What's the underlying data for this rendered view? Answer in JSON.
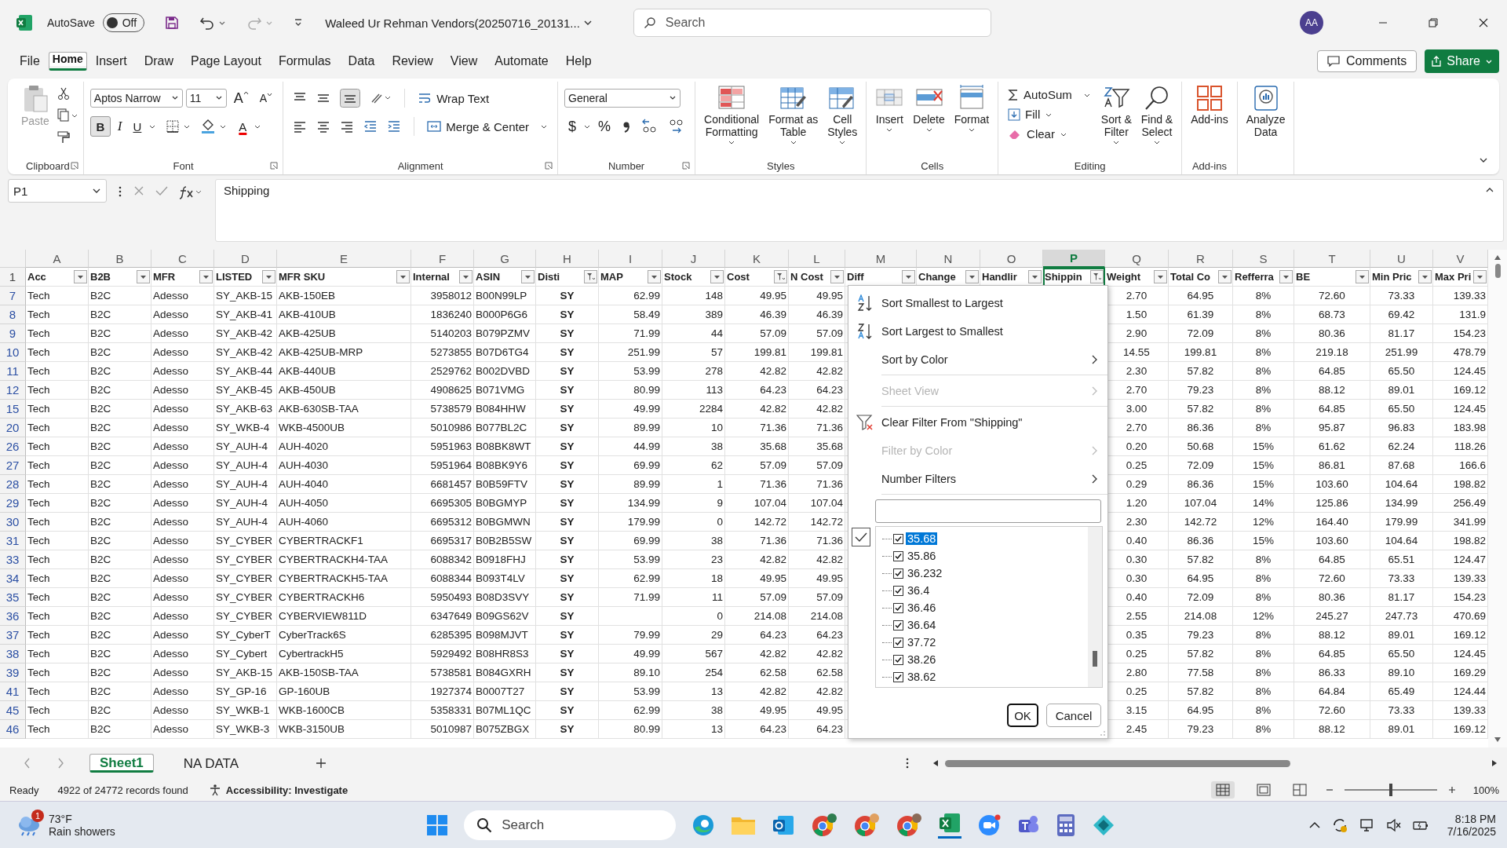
{
  "title_bar": {
    "autosave_label": "AutoSave",
    "autosave": {
      "on": false,
      "label": "Off"
    },
    "file_name": "Waleed Ur Rehman Vendors(20250716_20131...",
    "search_placeholder": "Search",
    "avatar": "AA"
  },
  "menu_tabs": [
    {
      "label": "File",
      "selected": false
    },
    {
      "label": "Home",
      "selected": true
    },
    {
      "label": "Insert",
      "selected": false
    },
    {
      "label": "Draw",
      "selected": false
    },
    {
      "label": "Page Layout",
      "selected": false
    },
    {
      "label": "Formulas",
      "selected": false
    },
    {
      "label": "Data",
      "selected": false
    },
    {
      "label": "Review",
      "selected": false
    },
    {
      "label": "View",
      "selected": false
    },
    {
      "label": "Automate",
      "selected": false
    },
    {
      "label": "Help",
      "selected": false
    }
  ],
  "comments": "Comments",
  "share": "Share",
  "ribbon": {
    "groups": [
      {
        "kind": "clipboard",
        "name": "Clipboard",
        "paste": {
          "label": "Paste",
          "disabled": true
        }
      },
      {
        "kind": "font",
        "name": "Font",
        "font": "Aptos Narrow",
        "size": "11",
        "grow": "A",
        "shrink": "A",
        "bold": {
          "label": "B",
          "on": true
        },
        "italic": "I",
        "underline": "U",
        "color_letter": "A"
      },
      {
        "kind": "alignment",
        "name": "Alignment",
        "wrap": "Wrap Text",
        "merge": "Merge & Center"
      },
      {
        "kind": "number",
        "name": "Number",
        "format": "General",
        "currency": "$",
        "percent": "%"
      },
      {
        "kind": "big",
        "name": "Styles",
        "buttons": [
          {
            "label": "Conditional\nFormatting",
            "caret": true
          },
          {
            "label": "Format as\nTable",
            "caret": true
          },
          {
            "label": "Cell\nStyles",
            "caret": true
          }
        ]
      },
      {
        "kind": "big",
        "name": "Cells",
        "buttons": [
          {
            "label": "Insert",
            "caret": true
          },
          {
            "label": "Delete",
            "caret": true
          },
          {
            "label": "Format",
            "caret": true
          }
        ]
      },
      {
        "kind": "editing",
        "name": "Editing",
        "autosum": "AutoSum",
        "fill": "Fill",
        "clear": "Clear",
        "buttons": [
          {
            "label": "Sort &\nFilter",
            "caret": true
          },
          {
            "label": "Find &\nSelect",
            "caret": true
          }
        ]
      },
      {
        "kind": "big",
        "name": "Add-ins",
        "buttons": [
          {
            "label": "Add-ins",
            "caret": false
          }
        ]
      },
      {
        "kind": "big",
        "buttons": [
          {
            "label": "Analyze\nData",
            "caret": false
          }
        ]
      }
    ]
  },
  "formula_bar": {
    "name_box": "P1",
    "formula": "Shipping"
  },
  "sheet": {
    "header_row": "1",
    "columns": [
      {
        "letter": "A",
        "selected": false
      },
      {
        "letter": "B",
        "selected": false
      },
      {
        "letter": "C",
        "selected": false
      },
      {
        "letter": "D",
        "selected": false
      },
      {
        "letter": "E",
        "selected": false
      },
      {
        "letter": "F",
        "selected": false
      },
      {
        "letter": "G",
        "selected": false
      },
      {
        "letter": "H",
        "selected": false
      },
      {
        "letter": "I",
        "selected": false
      },
      {
        "letter": "J",
        "selected": false
      },
      {
        "letter": "K",
        "selected": false
      },
      {
        "letter": "L",
        "selected": false
      },
      {
        "letter": "M",
        "selected": false
      },
      {
        "letter": "N",
        "selected": false
      },
      {
        "letter": "O",
        "selected": false
      },
      {
        "letter": "P",
        "selected": true
      },
      {
        "letter": "Q",
        "selected": false
      },
      {
        "letter": "R",
        "selected": false
      },
      {
        "letter": "S",
        "selected": false
      },
      {
        "letter": "T",
        "selected": false
      },
      {
        "letter": "U",
        "selected": false
      },
      {
        "letter": "V",
        "selected": false
      }
    ],
    "headers": [
      {
        "label": "Acc",
        "filtered": false
      },
      {
        "label": "B2B",
        "filtered": false
      },
      {
        "label": "MFR",
        "filtered": false
      },
      {
        "label": "LISTED",
        "filtered": false
      },
      {
        "label": "MFR SKU",
        "filtered": false
      },
      {
        "label": "Internal",
        "filtered": false
      },
      {
        "label": "ASIN",
        "filtered": false
      },
      {
        "label": "Disti",
        "filtered": true
      },
      {
        "label": "MAP",
        "filtered": false
      },
      {
        "label": "Stock",
        "filtered": false
      },
      {
        "label": "Cost",
        "filtered": true
      },
      {
        "label": "N Cost",
        "filtered": false
      },
      {
        "label": "Diff",
        "filtered": false
      },
      {
        "label": "Change",
        "filtered": false
      },
      {
        "label": "Handlir",
        "filtered": false
      },
      {
        "label": "Shippin",
        "filtered": true
      },
      {
        "label": "Weight",
        "filtered": false
      },
      {
        "label": "Total Co",
        "filtered": false
      },
      {
        "label": "Refferra",
        "filtered": false
      },
      {
        "label": "BE",
        "filtered": false
      },
      {
        "label": "Min Pric",
        "filtered": false
      },
      {
        "label": "Max Pri",
        "filtered": false
      }
    ],
    "rows": [
      {
        "row": "7",
        "cells": [
          "Tech",
          "B2C",
          "Adesso",
          "SY_AKB-15",
          "AKB-150EB",
          "3958012",
          "B00N99LP",
          "SY",
          "62.99",
          "148",
          "49.95",
          "49.95",
          null,
          null,
          null,
          null,
          "2.70",
          "64.95",
          "8%",
          "72.60",
          "73.33",
          "139.33"
        ]
      },
      {
        "row": "8",
        "cells": [
          "Tech",
          "B2C",
          "Adesso",
          "SY_AKB-41",
          "AKB-410UB",
          "1836240",
          "B000P6G6",
          "SY",
          "58.49",
          "389",
          "46.39",
          "46.39",
          null,
          null,
          null,
          null,
          "1.50",
          "61.39",
          "8%",
          "68.73",
          "69.42",
          "131.9"
        ]
      },
      {
        "row": "9",
        "cells": [
          "Tech",
          "B2C",
          "Adesso",
          "SY_AKB-42",
          "AKB-425UB",
          "5140203",
          "B079PZMV",
          "SY",
          "71.99",
          "44",
          "57.09",
          "57.09",
          null,
          null,
          null,
          null,
          "2.90",
          "72.09",
          "8%",
          "80.36",
          "81.17",
          "154.23"
        ]
      },
      {
        "row": "10",
        "cells": [
          "Tech",
          "B2C",
          "Adesso",
          "SY_AKB-42",
          "AKB-425UB-MRP",
          "5273855",
          "B07D6TG4",
          "SY",
          "251.99",
          "57",
          "199.81",
          "199.81",
          null,
          null,
          null,
          null,
          "14.55",
          "199.81",
          "8%",
          "219.18",
          "251.99",
          "478.79"
        ]
      },
      {
        "row": "11",
        "cells": [
          "Tech",
          "B2C",
          "Adesso",
          "SY_AKB-44",
          "AKB-440UB",
          "2529762",
          "B002DVBD",
          "SY",
          "53.99",
          "278",
          "42.82",
          "42.82",
          null,
          null,
          null,
          null,
          "2.30",
          "57.82",
          "8%",
          "64.85",
          "65.50",
          "124.45"
        ]
      },
      {
        "row": "12",
        "cells": [
          "Tech",
          "B2C",
          "Adesso",
          "SY_AKB-45",
          "AKB-450UB",
          "4908625",
          "B071VMG",
          "SY",
          "80.99",
          "113",
          "64.23",
          "64.23",
          null,
          null,
          null,
          null,
          "2.70",
          "79.23",
          "8%",
          "88.12",
          "89.01",
          "169.12"
        ]
      },
      {
        "row": "15",
        "cells": [
          "Tech",
          "B2C",
          "Adesso",
          "SY_AKB-63",
          "AKB-630SB-TAA",
          "5738579",
          "B084HHW",
          "SY",
          "49.99",
          "2284",
          "42.82",
          "42.82",
          null,
          null,
          null,
          null,
          "3.00",
          "57.82",
          "8%",
          "64.85",
          "65.50",
          "124.45"
        ]
      },
      {
        "row": "20",
        "cells": [
          "Tech",
          "B2C",
          "Adesso",
          "SY_WKB-4",
          "WKB-4500UB",
          "5010986",
          "B077BL2C",
          "SY",
          "89.99",
          "10",
          "71.36",
          "71.36",
          null,
          null,
          null,
          null,
          "2.70",
          "86.36",
          "8%",
          "95.87",
          "96.83",
          "183.98"
        ]
      },
      {
        "row": "26",
        "cells": [
          "Tech",
          "B2C",
          "Adesso",
          "SY_AUH-4",
          "AUH-4020",
          "5951963",
          "B08BK8WT",
          "SY",
          "44.99",
          "38",
          "35.68",
          "35.68",
          null,
          null,
          null,
          null,
          "0.20",
          "50.68",
          "15%",
          "61.62",
          "62.24",
          "118.26"
        ]
      },
      {
        "row": "27",
        "cells": [
          "Tech",
          "B2C",
          "Adesso",
          "SY_AUH-4",
          "AUH-4030",
          "5951964",
          "B08BK9Y6",
          "SY",
          "69.99",
          "62",
          "57.09",
          "57.09",
          null,
          null,
          null,
          null,
          "0.25",
          "72.09",
          "15%",
          "86.81",
          "87.68",
          "166.6"
        ]
      },
      {
        "row": "28",
        "cells": [
          "Tech",
          "B2C",
          "Adesso",
          "SY_AUH-4",
          "AUH-4040",
          "6681457",
          "B0B59FTV",
          "SY",
          "89.99",
          "1",
          "71.36",
          "71.36",
          null,
          null,
          null,
          null,
          "0.29",
          "86.36",
          "15%",
          "103.60",
          "104.64",
          "198.82"
        ]
      },
      {
        "row": "29",
        "cells": [
          "Tech",
          "B2C",
          "Adesso",
          "SY_AUH-4",
          "AUH-4050",
          "6695305",
          "B0BGMYP",
          "SY",
          "134.99",
          "9",
          "107.04",
          "107.04",
          null,
          null,
          null,
          null,
          "1.20",
          "107.04",
          "14%",
          "125.86",
          "134.99",
          "256.49"
        ]
      },
      {
        "row": "30",
        "cells": [
          "Tech",
          "B2C",
          "Adesso",
          "SY_AUH-4",
          "AUH-4060",
          "6695312",
          "B0BGMWN",
          "SY",
          "179.99",
          "0",
          "142.72",
          "142.72",
          null,
          null,
          null,
          null,
          "2.30",
          "142.72",
          "12%",
          "164.40",
          "179.99",
          "341.99"
        ]
      },
      {
        "row": "31",
        "cells": [
          "Tech",
          "B2C",
          "Adesso",
          "SY_CYBER",
          "CYBERTRACKF1",
          "6695317",
          "B0B2B5SW",
          "SY",
          "69.99",
          "38",
          "71.36",
          "71.36",
          null,
          null,
          null,
          null,
          "0.40",
          "86.36",
          "15%",
          "103.60",
          "104.64",
          "198.82"
        ]
      },
      {
        "row": "33",
        "cells": [
          "Tech",
          "B2C",
          "Adesso",
          "SY_CYBER",
          "CYBERTRACKH4-TAA",
          "6088342",
          "B0918FHJ",
          "SY",
          "53.99",
          "23",
          "42.82",
          "42.82",
          null,
          null,
          null,
          null,
          "0.30",
          "57.82",
          "8%",
          "64.85",
          "65.51",
          "124.47"
        ]
      },
      {
        "row": "34",
        "cells": [
          "Tech",
          "B2C",
          "Adesso",
          "SY_CYBER",
          "CYBERTRACKH5-TAA",
          "6088344",
          "B093T4LV",
          "SY",
          "62.99",
          "18",
          "49.95",
          "49.95",
          null,
          null,
          null,
          null,
          "0.30",
          "64.95",
          "8%",
          "72.60",
          "73.33",
          "139.33"
        ]
      },
      {
        "row": "35",
        "cells": [
          "Tech",
          "B2C",
          "Adesso",
          "SY_CYBER",
          "CYBERTRACKH6",
          "5950493",
          "B08D3SVY",
          "SY",
          "71.99",
          "11",
          "57.09",
          "57.09",
          null,
          null,
          null,
          null,
          "0.40",
          "72.09",
          "8%",
          "80.36",
          "81.17",
          "154.23"
        ]
      },
      {
        "row": "36",
        "cells": [
          "Tech",
          "B2C",
          "Adesso",
          "SY_CYBER",
          "CYBERVIEW811D",
          "6347649",
          "B09GS62V",
          "SY",
          null,
          "0",
          "214.08",
          "214.08",
          null,
          null,
          null,
          null,
          "2.55",
          "214.08",
          "12%",
          "245.27",
          "247.73",
          "470.69"
        ]
      },
      {
        "row": "37",
        "cells": [
          "Tech",
          "B2C",
          "Adesso",
          "SY_CyberT",
          "CyberTrack6S",
          "6285395",
          "B098MJVT",
          "SY",
          "79.99",
          "29",
          "64.23",
          "64.23",
          null,
          null,
          null,
          null,
          "0.35",
          "79.23",
          "8%",
          "88.12",
          "89.01",
          "169.12"
        ]
      },
      {
        "row": "38",
        "cells": [
          "Tech",
          "B2C",
          "Adesso",
          "SY_Cybert",
          "CybertrackH5",
          "5929492",
          "B08HR8S3",
          "SY",
          "49.99",
          "567",
          "42.82",
          "42.82",
          null,
          null,
          null,
          null,
          "0.25",
          "57.82",
          "8%",
          "64.85",
          "65.50",
          "124.45"
        ]
      },
      {
        "row": "39",
        "cells": [
          "Tech",
          "B2C",
          "Adesso",
          "SY_AKB-15",
          "AKB-150SB-TAA",
          "5738581",
          "B084GXRH",
          "SY",
          "89.10",
          "254",
          "62.58",
          "62.58",
          null,
          null,
          null,
          null,
          "2.80",
          "77.58",
          "8%",
          "86.33",
          "89.10",
          "169.29"
        ]
      },
      {
        "row": "41",
        "cells": [
          "Tech",
          "B2C",
          "Adesso",
          "SY_GP-16",
          "GP-160UB",
          "1927374",
          "B0007T27",
          "SY",
          "53.99",
          "13",
          "42.82",
          "42.82",
          null,
          null,
          null,
          null,
          "0.25",
          "57.82",
          "8%",
          "64.84",
          "65.49",
          "124.44"
        ]
      },
      {
        "row": "45",
        "cells": [
          "Tech",
          "B2C",
          "Adesso",
          "SY_WKB-1",
          "WKB-1600CB",
          "5358331",
          "B07ML1QC",
          "SY",
          "62.99",
          "38",
          "49.95",
          "49.95",
          null,
          null,
          null,
          null,
          "3.15",
          "64.95",
          "8%",
          "72.60",
          "73.33",
          "139.33"
        ]
      },
      {
        "row": "46",
        "cells": [
          "Tech",
          "B2C",
          "Adesso",
          "SY_WKB-3",
          "WKB-3150UB",
          "5010987",
          "B075ZBGX",
          "SY",
          "80.99",
          "13",
          "64.23",
          "64.23",
          null,
          null,
          null,
          null,
          "2.45",
          "79.23",
          "8%",
          "88.12",
          "89.01",
          "169.12"
        ]
      }
    ]
  },
  "filter_menu": {
    "items": [
      {
        "kind": "action",
        "label": "Sort Smallest to Largest",
        "disabled": false
      },
      {
        "kind": "action",
        "label": "Sort Largest to Smallest",
        "disabled": false
      },
      {
        "kind": "submenu",
        "label": "Sort by Color",
        "disabled": false
      },
      {
        "kind": "separator"
      },
      {
        "kind": "submenu",
        "label": "Sheet View",
        "disabled": true
      },
      {
        "kind": "separator"
      },
      {
        "kind": "action",
        "label": "Clear Filter From \"Shipping\"",
        "disabled": false
      },
      {
        "kind": "submenu",
        "label": "Filter by Color",
        "disabled": true
      },
      {
        "kind": "submenu",
        "label": "Number Filters",
        "disabled": false
      },
      {
        "kind": "separator"
      }
    ],
    "values": [
      {
        "label": "35.68",
        "checked": true,
        "selected": true
      },
      {
        "label": "35.86",
        "checked": true,
        "selected": false
      },
      {
        "label": "36.232",
        "checked": true,
        "selected": false
      },
      {
        "label": "36.4",
        "checked": true,
        "selected": false
      },
      {
        "label": "36.46",
        "checked": true,
        "selected": false
      },
      {
        "label": "36.64",
        "checked": true,
        "selected": false
      },
      {
        "label": "37.72",
        "checked": true,
        "selected": false
      },
      {
        "label": "38.26",
        "checked": true,
        "selected": false
      },
      {
        "label": "38.62",
        "checked": true,
        "selected": false
      }
    ],
    "ok": "OK",
    "cancel": "Cancel"
  },
  "sheet_tabs": [
    {
      "label": "Sheet1",
      "selected": true
    },
    {
      "label": "NA DATA",
      "selected": false
    }
  ],
  "status_bar": {
    "ready": "Ready",
    "records": "4922 of 24772 records found",
    "accessibility": "Accessibility: Investigate",
    "zoom_slider": {
      "level": 0.5
    },
    "zoom": "100%"
  },
  "taskbar": {
    "weather_badge": "1",
    "temperature": "73°F",
    "weather": "Rain showers",
    "search": "Search",
    "time": "8:18 PM",
    "date": "7/16/2025"
  }
}
